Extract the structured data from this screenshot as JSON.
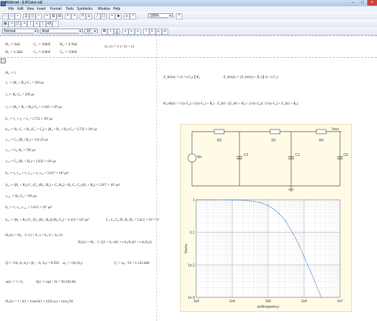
{
  "window": {
    "title": "Mathcad - [LRCams.xd]",
    "buttons": [
      "–",
      "□",
      "×"
    ]
  },
  "menu": [
    "File",
    "Edit",
    "View",
    "Insert",
    "Format",
    "Tools",
    "Symbolics",
    "Window",
    "Help"
  ],
  "toolbar": {
    "zoom": "100%",
    "style": "Normal",
    "font": "Arial",
    "size": "10",
    "bold": "B",
    "italic": "I",
    "underline": "U"
  },
  "definitions": {
    "r2": "R₂ := 1kΩ",
    "c1": "C₁ := 100nF",
    "r0": "R₀ := 4.7kΩ",
    "xy": "(x, y) := x·y / (x + y)",
    "r1": "R₁ := 2.2kΩ",
    "c2": "C₂ := 220nF",
    "c0": "C₀ := 150nF"
  },
  "equations": [
    "H₀ := 1",
    "τ₁ := (R₁ + R₂)·C₁ = 320 μs",
    "τ₂ := R₂·C₂ = 220 μs",
    "τ₃ := (R₀ + R₁ + R₂)·C₀ = 1.185 × 10³ μs",
    "b₁ := τ₁ + τ₂ + τ₃ = 1.725 × 10³ μs",
    "b₁₂ := R₁·C₁ + R₂·(C₁ + C₂) + (R₀ + R₁ + R₂)·C₀ = 3.725 × 10³ μs",
    "τ₁₂ := C₁·(R₁ | R₂) = 151.25 μs",
    "τ₁₃ := C₀·R₀ = 705 μs",
    "τ₂₃ := C₀·(R₁ + R₀) = 1.035 × 10³ μs",
    "b₂ := τ₁·τ₁₂ + τ₁·τ₁₃ + τ₂·τ₂₃ = 5.017 × 10⁵ μs²",
    "b₂ₐ := (R₁ + R₂)·C₁·[C₂·(R₁ | R₂) + C₀·R₀] + R₂·C₂·C₀·(R₁ + R₀) = 5.017 × 10⁵ μs²",
    "τ₁₂₃ := R₀·C₀ = 705 μs",
    "b₃ := τ₁·τ₁₂·τ₁₂₃ = 3.412 × 10⁷ μs³",
    "b₃ₐ := (R₁ + R₂)·C₁·[C₂·(R₁ | R₂)]·(R₀·C₀) = 3.412 × 10⁷ μs³",
    "C₁·C₂·C₀·R₁·R₂·R₀ = 3.412 × 10⁻¹¹ s³",
    "H₁(s) := H₀ · 1 / (1 + b₁·s + b₂·s² + b₃·s³)",
    "H₂(s) := H₀ · 1 / ((1 + b₁·s)(1 + s·b₂/b₁)(1 + s·b₃/b₂))",
    "Q := √(b₂·b₁·b₃) / (b₂ − b₁·b₃) = 0.350",
    "ω₀ := √(b₁/b₃)",
    "f₀ := ω₀ / 2π = 1.132 kHz",
    "ωp1 := 1 / b₁",
    "fp1 := ωp1 / 2π = 92.264 Hz",
    "H₃(s) := 1 / ((1 + s/ωp1)(1 + s/(Q·ω₀) + (s/ω₀)²))"
  ],
  "right_equations": [
    "Z_th1(s) := (1 / s·C₂) ∥ R₂",
    "Z_th2(s) := (Z_th1(s) + R₁) ∥ (1 / s·C₁)",
    "H_ref(s) := 1/(s·C₂) / (1/(s·C₂) + R₂) · Z_th1 / (Z_th1 + R₁) · (1/(s·C₀)) / (1/(s·C₀) + Z_th2 + R₀)"
  ],
  "schematic": {
    "labels": [
      "R2",
      "R1",
      "R0",
      "Vin",
      "C2",
      "C1",
      "C0",
      "Vout"
    ]
  },
  "chart_data": {
    "type": "line",
    "title": "",
    "xlabel": "actfrequency",
    "ylabel": "Vout ▸",
    "xscale": "log",
    "yscale": "log",
    "xlim": [
      1000,
      10000000
    ],
    "ylim": [
      0.001,
      1
    ],
    "xtick_labels": [
      "1e3",
      "1e4",
      "1e5",
      "1e6",
      "1e7"
    ],
    "ytick_labels": [
      "1",
      "0.1",
      "1e-2",
      "1e-3"
    ],
    "grid": true,
    "series": [
      {
        "x": [
          1000,
          10000,
          20000,
          40000,
          60000,
          100000,
          150000,
          200000,
          300000,
          500000,
          700000,
          1000000,
          1500000,
          2000000,
          3000000
        ],
        "values": [
          1,
          0.99,
          0.97,
          0.9,
          0.82,
          0.66,
          0.5,
          0.38,
          0.23,
          0.09,
          0.045,
          0.018,
          0.0065,
          0.003,
          0.001
        ]
      }
    ]
  }
}
